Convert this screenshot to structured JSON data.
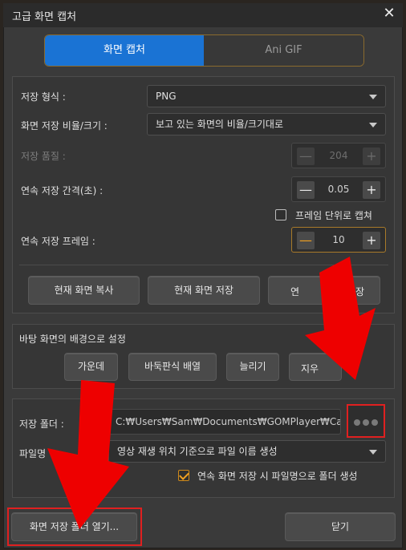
{
  "window": {
    "title": "고급 화면 캡처",
    "close_glyph": "✕"
  },
  "tabs": [
    {
      "label": "화면 캡처"
    },
    {
      "label": "Ani GIF"
    }
  ],
  "settings": {
    "format_label": "저장 형식 :",
    "format_value": "PNG",
    "ratio_label": "화면 저장 비율/크기 :",
    "ratio_value": "보고 있는 화면의 비율/크기대로",
    "quality_label": "저장 품질 :",
    "quality_value": "204",
    "interval_label": "연속 저장 간격(초) :",
    "interval_value": "0.05",
    "frame_unit_label": "프레임 단위로 캡쳐",
    "frames_label": "연속 저장 프레임 :",
    "frames_value": "10",
    "minus_glyph": "—",
    "plus_glyph": "+"
  },
  "actions": {
    "copy_label": "현재 화면 복사",
    "save_label": "현재 화면 저장",
    "continuous_left": "연",
    "continuous_right": "저장"
  },
  "wallpaper": {
    "heading": "바탕 화면의 배경으로 설정",
    "center": "가운데",
    "tile": "바둑판식 배열",
    "stretch": "늘리기",
    "remove_partial": "지우"
  },
  "folder": {
    "label": "저장 폴더 :",
    "path": "C:₩Users₩Sam₩Documents₩GOMPlayer₩Cap",
    "filename_label_partial": "파일명",
    "filename_value_partial": "영상 재생 위치 기준으로 파일 이름 생성",
    "folder_create_label": "연속 화면 저장 시 파일명으로 폴더 생성"
  },
  "footer": {
    "open_folder": "화면 저장 폴더 열기...",
    "close": "닫기"
  },
  "colors": {
    "accent": "#1a73d4",
    "highlight": "#e02020",
    "check": "#f0a020"
  }
}
